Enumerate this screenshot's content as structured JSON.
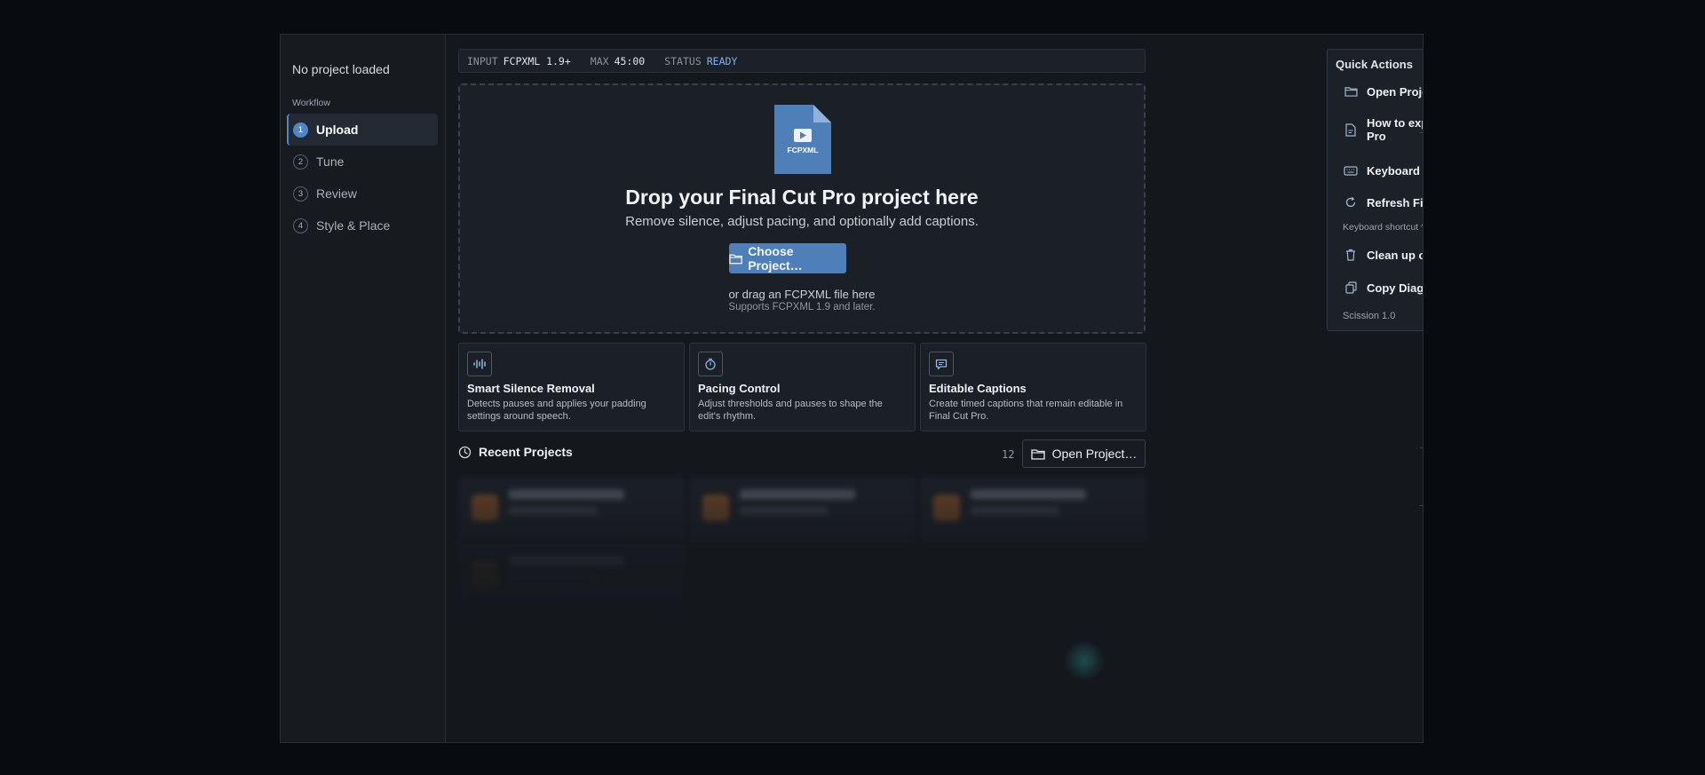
{
  "sidebar": {
    "project_status": "No project loaded",
    "workflow_label": "Workflow",
    "steps": [
      {
        "num": "1",
        "label": "Upload",
        "active": true
      },
      {
        "num": "2",
        "label": "Tune"
      },
      {
        "num": "3",
        "label": "Review"
      },
      {
        "num": "4",
        "label": "Style & Place"
      }
    ]
  },
  "status_bar": {
    "input_key": "INPUT",
    "input_val": "FCPXML 1.9+",
    "max_key": "MAX",
    "max_val": "45:00",
    "status_key": "STATUS",
    "status_val": "READY",
    "ready_color": "#7fb0e8"
  },
  "dropzone": {
    "file_icon_label": "FCPXML",
    "title": "Drop your Final Cut Pro project here",
    "subtitle": "Remove silence, adjust pacing, and optionally add captions.",
    "choose_button": "Choose Project…",
    "drag_hint": "or drag an FCPXML file here",
    "supports": "Supports FCPXML 1.9 and later."
  },
  "features": [
    {
      "icon": "waveform-icon",
      "title": "Smart Silence Removal",
      "desc": "Detects pauses and applies your padding settings around speech."
    },
    {
      "icon": "timer-icon",
      "title": "Pacing Control",
      "desc": "Adjust thresholds and pauses to shape the edit's rhythm."
    },
    {
      "icon": "caption-bubble-icon",
      "title": "Editable Captions",
      "desc": "Create timed captions that remain editable in Final Cut Pro."
    }
  ],
  "recent": {
    "title": "Recent Projects",
    "count": "12",
    "open_button": "Open Project…"
  },
  "quick_actions": {
    "title": "Quick Actions",
    "items": [
      {
        "icon": "folder-icon",
        "label": "Open Project…"
      },
      {
        "icon": "document-icon",
        "label": "How to export from Final Cut Pro"
      },
      {
        "icon": "keyboard-icon",
        "label": "Keyboard Shortcuts"
      },
      {
        "icon": "refresh-icon",
        "label": "Refresh Final Cut…"
      },
      {
        "icon": "trash-icon",
        "label": "Clean up old caption data…"
      },
      {
        "icon": "copy-icon",
        "label": "Copy Diagnostics"
      }
    ],
    "shortcut_note": "Keyboard shortcut ^⇧⌘R — on",
    "version": "Scission 1.0"
  },
  "colors": {
    "accent": "#4f86c6",
    "button": "#4f7fb8",
    "file_icon": "#4f7fb8"
  }
}
